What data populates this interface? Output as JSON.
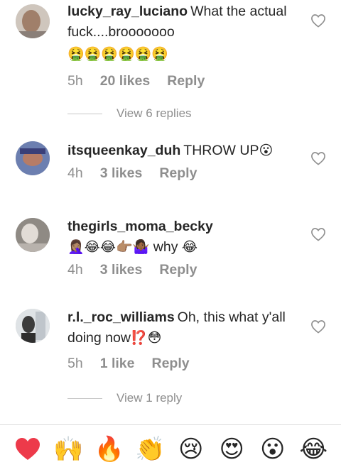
{
  "comments": [
    {
      "username": "lucky_ray_luciano",
      "text": "What the actual fuck....brooooooo",
      "emojis": "🤮🤮🤮🤮🤮🤮",
      "time": "5h",
      "likes": "20 likes",
      "reply": "Reply",
      "view_replies": "View 6 replies"
    },
    {
      "username": "itsqueenkay_duh",
      "text": "THROW UP",
      "emojis": "😮",
      "time": "4h",
      "likes": "3 likes",
      "reply": "Reply"
    },
    {
      "username": "thegirls_moma_becky",
      "text_emojis": "🤦🏽‍♀️😂😂👉🏽🤷🏾‍♀️",
      "text": "why",
      "emojis": "😂",
      "time": "4h",
      "likes": "3 likes",
      "reply": "Reply"
    },
    {
      "username": "r.l._roc_williams",
      "text": "Oh, this what y'all doing now",
      "emojis": "⁉️😳",
      "time": "5h",
      "likes": "1 like",
      "reply": "Reply",
      "view_replies": "View 1 reply"
    }
  ],
  "emoji_bar": [
    "❤️",
    "🙌",
    "🔥",
    "👏",
    "😢",
    "😍",
    "😮",
    "😂"
  ],
  "colors": {
    "text": "#262626",
    "secondary": "#8e8e8e",
    "heart": "#ed4956"
  }
}
